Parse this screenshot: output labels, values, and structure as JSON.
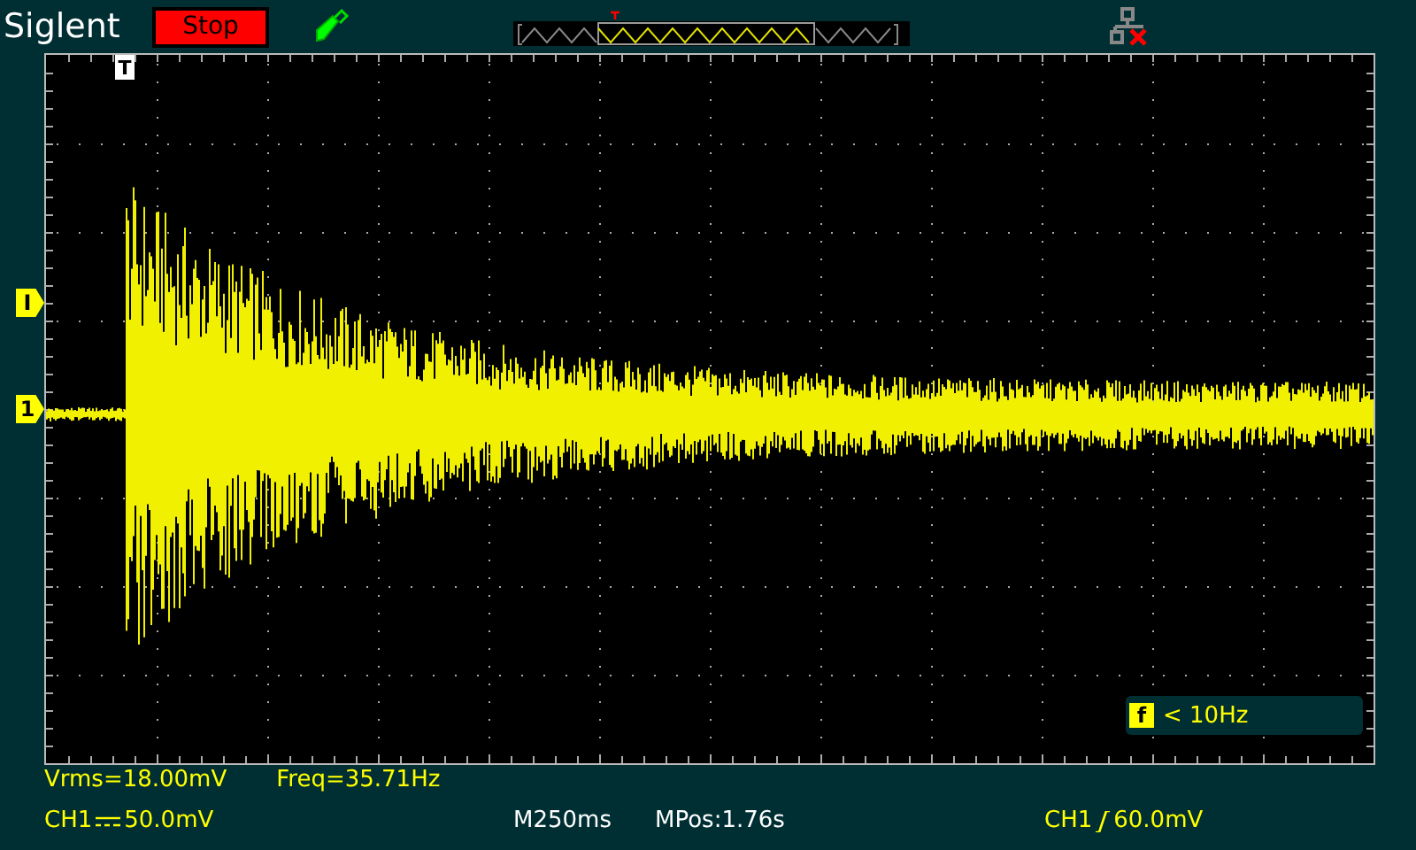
{
  "header": {
    "brand": "Siglent",
    "run_state": "Stop"
  },
  "trigger_marker": "T",
  "channel_markers": [
    {
      "label": "I",
      "kind": "trigger-level"
    },
    {
      "label": "1",
      "kind": "channel"
    }
  ],
  "filter_note": {
    "icon_letter": "f",
    "text": "< 10Hz"
  },
  "measurements": [
    "Vrms=18.00mV",
    "Freq=35.71Hz"
  ],
  "status": {
    "channel": "CH1",
    "volts_div": "50.0mV",
    "timebase": "M250ms",
    "position": "MPos:1.76s",
    "trigger_source": "CH1",
    "trigger_level": "60.0mV"
  }
}
